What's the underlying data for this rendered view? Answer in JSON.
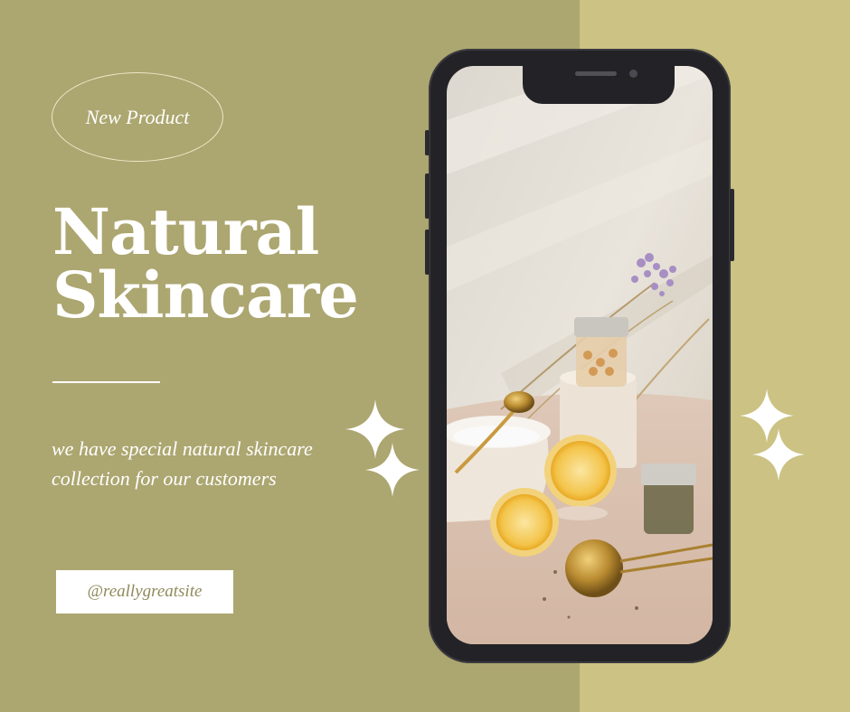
{
  "badge": {
    "label": "New Product"
  },
  "title": {
    "line1": "Natural",
    "line2": "Skincare"
  },
  "description": "we have special natural skincare collection for our customers",
  "cta": {
    "label": "@reallygreatsite"
  },
  "colors": {
    "background_left": "#aca670",
    "background_right": "#cbc283",
    "text": "#ffffff",
    "phone_frame": "#232327"
  },
  "phone_image": {
    "subject": "skincare jars, sliced lemons, gold spoon and tea infuser with dried lavender on cream background"
  }
}
